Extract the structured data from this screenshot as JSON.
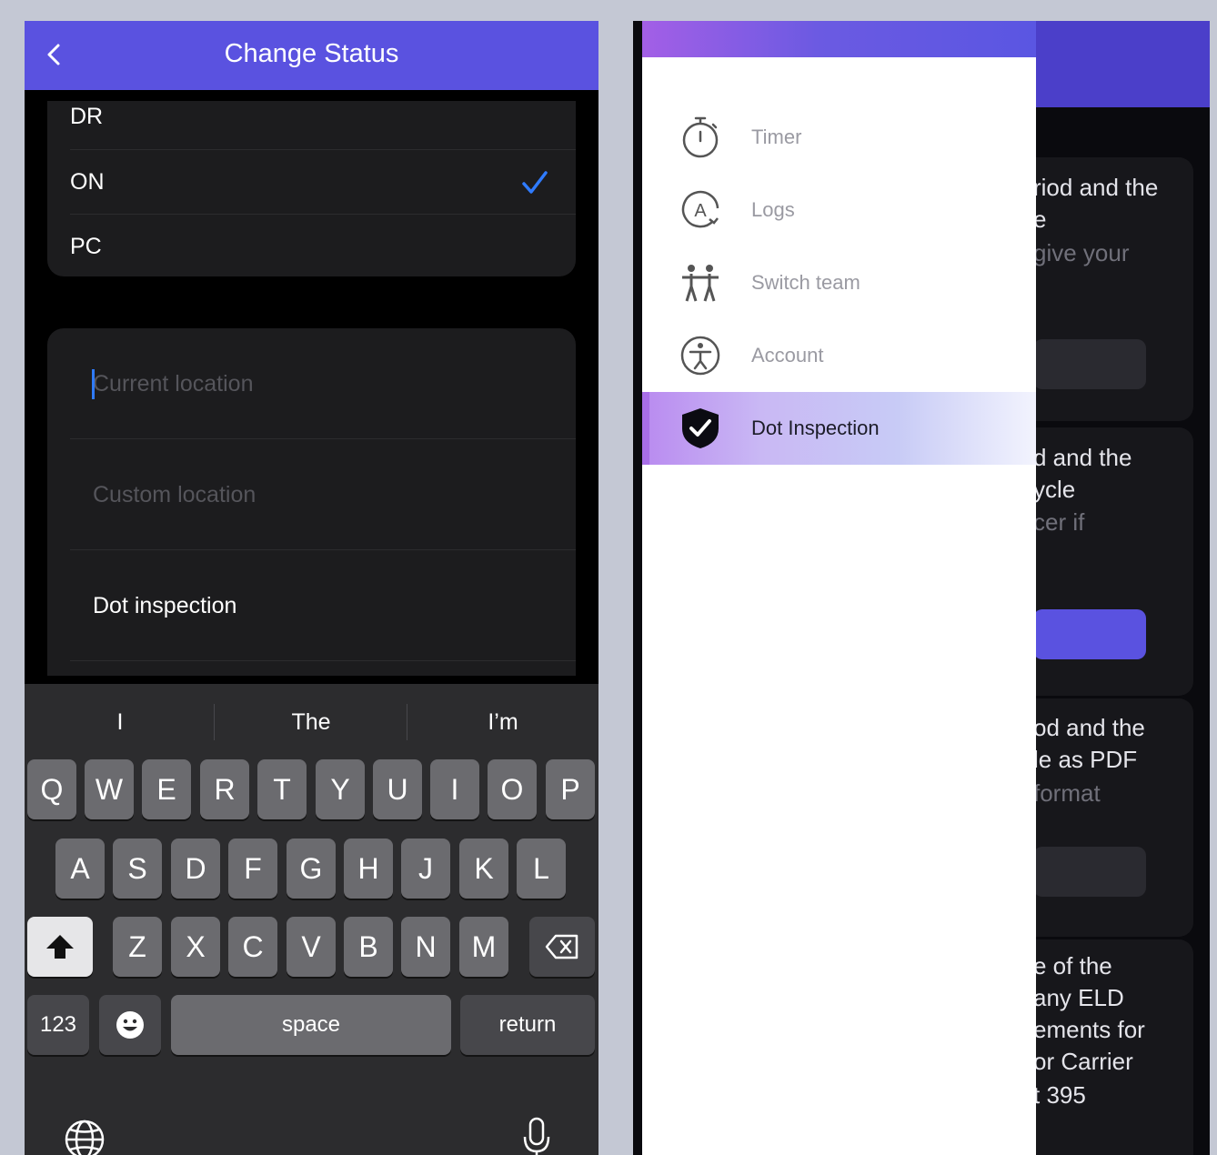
{
  "left": {
    "title": "Change Status",
    "statuses": [
      {
        "label": "DR",
        "selected": false
      },
      {
        "label": "ON",
        "selected": true
      },
      {
        "label": "PC",
        "selected": false
      }
    ],
    "location": {
      "current_placeholder": "Current location",
      "custom_placeholder": "Custom location",
      "dot_inspection": "Dot inspection"
    },
    "keyboard": {
      "suggestions": [
        "I",
        "The",
        "I’m"
      ],
      "row1": [
        "Q",
        "W",
        "E",
        "R",
        "T",
        "Y",
        "U",
        "I",
        "O",
        "P"
      ],
      "row2": [
        "A",
        "S",
        "D",
        "F",
        "G",
        "H",
        "J",
        "K",
        "L"
      ],
      "row3": [
        "Z",
        "X",
        "C",
        "V",
        "B",
        "N",
        "M"
      ],
      "numbers_label": "123",
      "space_label": "space",
      "return_label": "return"
    },
    "colors": {
      "accent": "#5a52e0",
      "check": "#2f7bff"
    }
  },
  "right": {
    "menu": [
      {
        "label": "Timer",
        "icon": "stopwatch-icon",
        "active": false
      },
      {
        "label": "Logs",
        "icon": "logs-icon",
        "active": false
      },
      {
        "label": "Switch team",
        "icon": "team-icon",
        "active": false
      },
      {
        "label": "Account",
        "icon": "account-icon",
        "active": false
      },
      {
        "label": "Dot Inspection",
        "icon": "shield-check-icon",
        "active": true
      }
    ],
    "background_text": {
      "card1": [
        "riod and the",
        "e",
        "give your"
      ],
      "card2": [
        "d and the",
        "ycle",
        "cer if"
      ],
      "card3": [
        "od and the",
        "le as PDF",
        "format"
      ],
      "card4": [
        "e of the",
        "any ELD",
        "ements for",
        "or Carrier",
        "t 395"
      ]
    },
    "colors": {
      "nav": "#4b3fc9",
      "active_marker": "#a86ee8"
    }
  }
}
